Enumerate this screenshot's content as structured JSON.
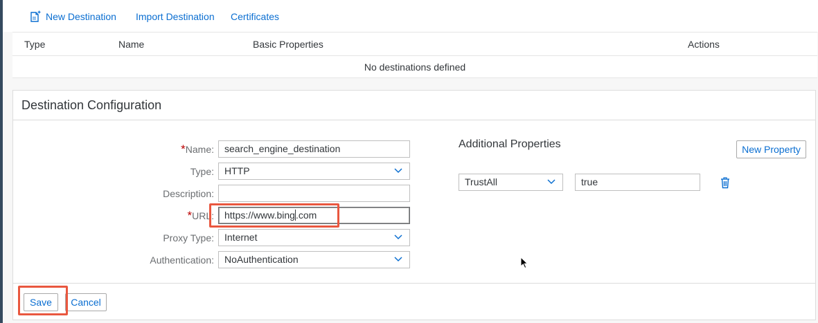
{
  "toolbar": {
    "new_destination": "New Destination",
    "import_destination": "Import Destination",
    "certificates": "Certificates"
  },
  "table": {
    "headers": [
      "Type",
      "Name",
      "Basic Properties",
      "Actions"
    ],
    "empty_message": "No destinations defined"
  },
  "config": {
    "title": "Destination Configuration",
    "labels": {
      "name": "Name:",
      "type": "Type:",
      "description": "Description:",
      "url": "URL:",
      "proxy_type": "Proxy Type:",
      "authentication": "Authentication:"
    },
    "required_marker": "*",
    "values": {
      "name": "search_engine_destination",
      "type": "HTTP",
      "description": "",
      "url_before_caret": "https://www.bing",
      "url_after_caret": ".com",
      "proxy_type": "Internet",
      "authentication": "NoAuthentication"
    }
  },
  "additional": {
    "title": "Additional Properties",
    "new_property_label": "New Property",
    "property_key": "TrustAll",
    "property_value": "true"
  },
  "footer": {
    "save_label": "Save",
    "cancel_label": "Cancel"
  },
  "colors": {
    "accent": "#0a6ed1",
    "required": "#bb0000",
    "highlight": "#e9573f",
    "edge": "#354a5f"
  }
}
